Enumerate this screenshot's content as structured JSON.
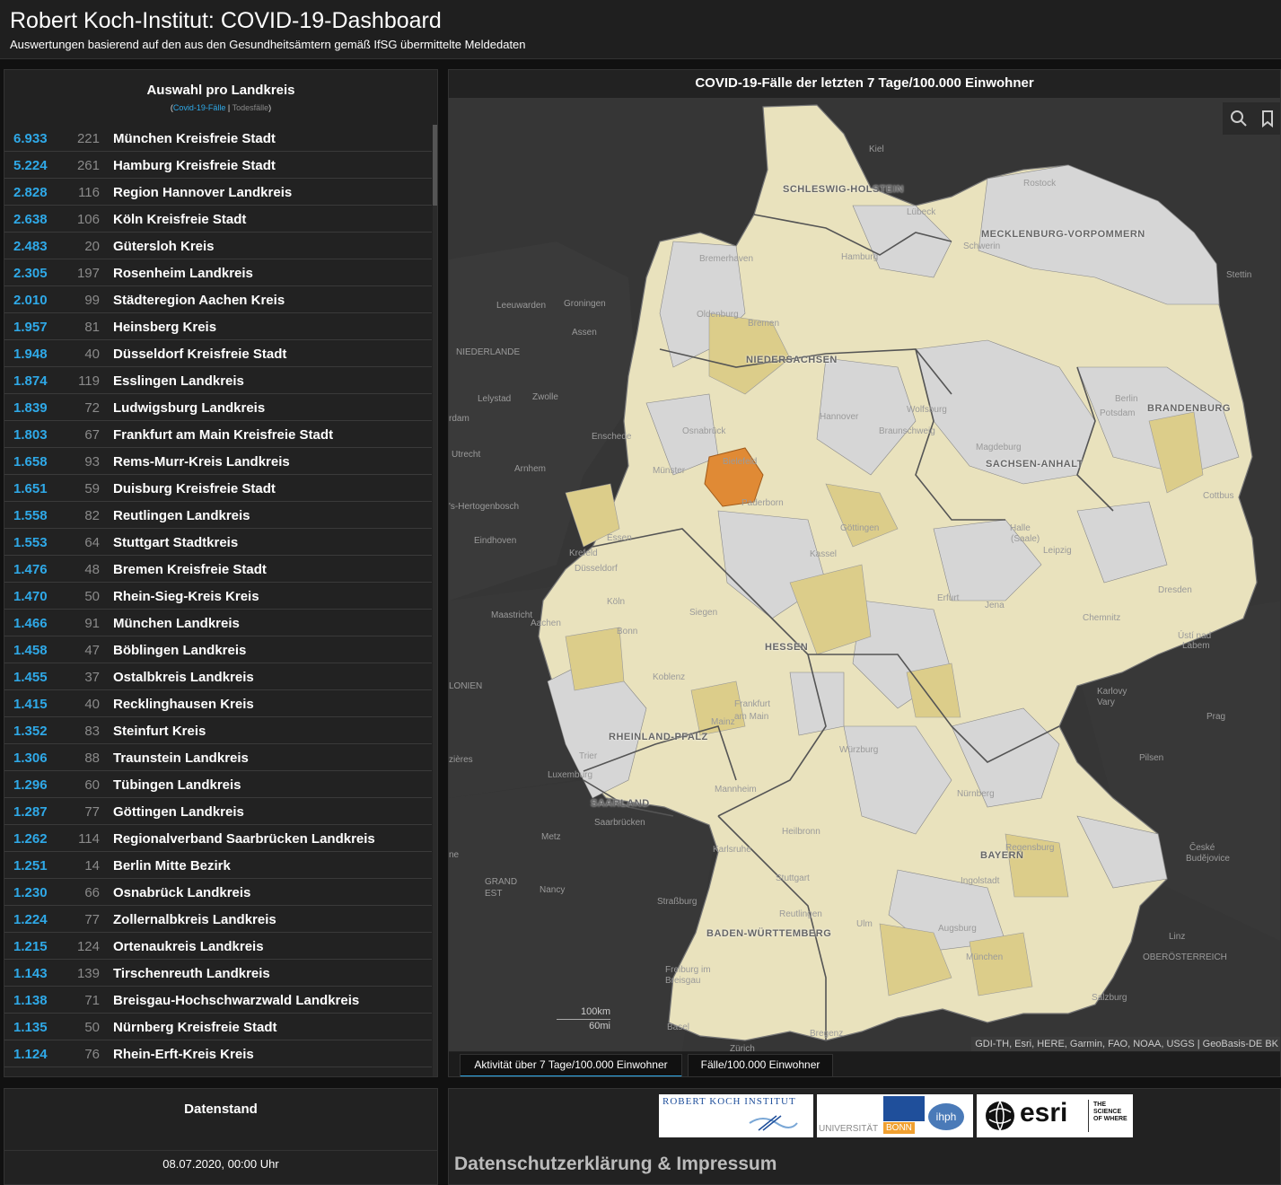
{
  "header": {
    "title": "Robert Koch-Institut: COVID-19-Dashboard",
    "subtitle": "Auswertungen basierend auf den aus den Gesundheitsämtern gemäß IfSG übermittelte Meldedaten"
  },
  "list_panel": {
    "title": "Auswahl pro Landkreis",
    "legend_open": "(",
    "legend_cases": "Covid-19-Fälle",
    "legend_sep": " | ",
    "legend_deaths": "Todesfälle",
    "legend_close": ")",
    "rows": [
      {
        "cases": "6.933",
        "deaths": "221",
        "name": "München Kreisfreie Stadt"
      },
      {
        "cases": "5.224",
        "deaths": "261",
        "name": "Hamburg Kreisfreie Stadt"
      },
      {
        "cases": "2.828",
        "deaths": "116",
        "name": "Region Hannover Landkreis"
      },
      {
        "cases": "2.638",
        "deaths": "106",
        "name": "Köln Kreisfreie Stadt"
      },
      {
        "cases": "2.483",
        "deaths": "20",
        "name": "Gütersloh Kreis"
      },
      {
        "cases": "2.305",
        "deaths": "197",
        "name": "Rosenheim Landkreis"
      },
      {
        "cases": "2.010",
        "deaths": "99",
        "name": "Städteregion Aachen Kreis"
      },
      {
        "cases": "1.957",
        "deaths": "81",
        "name": "Heinsberg Kreis"
      },
      {
        "cases": "1.948",
        "deaths": "40",
        "name": "Düsseldorf Kreisfreie Stadt"
      },
      {
        "cases": "1.874",
        "deaths": "119",
        "name": "Esslingen Landkreis"
      },
      {
        "cases": "1.839",
        "deaths": "72",
        "name": "Ludwigsburg Landkreis"
      },
      {
        "cases": "1.803",
        "deaths": "67",
        "name": "Frankfurt am Main Kreisfreie Stadt"
      },
      {
        "cases": "1.658",
        "deaths": "93",
        "name": "Rems-Murr-Kreis Landkreis"
      },
      {
        "cases": "1.651",
        "deaths": "59",
        "name": "Duisburg Kreisfreie Stadt"
      },
      {
        "cases": "1.558",
        "deaths": "82",
        "name": "Reutlingen Landkreis"
      },
      {
        "cases": "1.553",
        "deaths": "64",
        "name": "Stuttgart Stadtkreis"
      },
      {
        "cases": "1.476",
        "deaths": "48",
        "name": "Bremen Kreisfreie Stadt"
      },
      {
        "cases": "1.470",
        "deaths": "50",
        "name": "Rhein-Sieg-Kreis Kreis"
      },
      {
        "cases": "1.466",
        "deaths": "91",
        "name": "München Landkreis"
      },
      {
        "cases": "1.458",
        "deaths": "47",
        "name": "Böblingen Landkreis"
      },
      {
        "cases": "1.455",
        "deaths": "37",
        "name": "Ostalbkreis Landkreis"
      },
      {
        "cases": "1.415",
        "deaths": "40",
        "name": "Recklinghausen Kreis"
      },
      {
        "cases": "1.352",
        "deaths": "83",
        "name": "Steinfurt Kreis"
      },
      {
        "cases": "1.306",
        "deaths": "88",
        "name": "Traunstein Landkreis"
      },
      {
        "cases": "1.296",
        "deaths": "60",
        "name": "Tübingen Landkreis"
      },
      {
        "cases": "1.287",
        "deaths": "77",
        "name": "Göttingen Landkreis"
      },
      {
        "cases": "1.262",
        "deaths": "114",
        "name": "Regionalverband Saarbrücken Landkreis"
      },
      {
        "cases": "1.251",
        "deaths": "14",
        "name": "Berlin Mitte Bezirk"
      },
      {
        "cases": "1.230",
        "deaths": "66",
        "name": "Osnabrück Landkreis"
      },
      {
        "cases": "1.224",
        "deaths": "77",
        "name": "Zollernalbkreis Landkreis"
      },
      {
        "cases": "1.215",
        "deaths": "124",
        "name": "Ortenaukreis Landkreis"
      },
      {
        "cases": "1.143",
        "deaths": "139",
        "name": "Tirschenreuth Landkreis"
      },
      {
        "cases": "1.138",
        "deaths": "71",
        "name": "Breisgau-Hochschwarzwald Landkreis"
      },
      {
        "cases": "1.135",
        "deaths": "50",
        "name": "Nürnberg Kreisfreie Stadt"
      },
      {
        "cases": "1.124",
        "deaths": "76",
        "name": "Rhein-Erft-Kreis Kreis"
      }
    ]
  },
  "map_panel": {
    "title": "COVID-19-Fälle der letzten 7 Tage/100.000 Einwohner",
    "tools": {
      "search_icon": "search-icon",
      "bookmark_icon": "bookmark-icon"
    },
    "states": [
      {
        "label": "SCHLESWIG-HOLSTEIN"
      },
      {
        "label": "MECKLENBURG-VORPOMMERN"
      },
      {
        "label": "NIEDERSACHSEN"
      },
      {
        "label": "BRANDENBURG"
      },
      {
        "label": "SACHSEN-ANHALT"
      },
      {
        "label": "HESSEN"
      },
      {
        "label": "RHEINLAND-PFALZ"
      },
      {
        "label": "SAARLAND"
      },
      {
        "label": "BAYERN"
      },
      {
        "label": "BADEN-WÜRTTEMBERG"
      }
    ],
    "cities": [
      {
        "label": "Kiel"
      },
      {
        "label": "Rostock"
      },
      {
        "label": "Lübeck"
      },
      {
        "label": "Schwerin"
      },
      {
        "label": "Hamburg"
      },
      {
        "label": "Bremerhaven"
      },
      {
        "label": "Stettin"
      },
      {
        "label": "Oldenburg"
      },
      {
        "label": "Bremen"
      },
      {
        "label": "Groningen"
      },
      {
        "label": "Leeuwarden"
      },
      {
        "label": "Assen"
      },
      {
        "label": "NIEDERLANDE"
      },
      {
        "label": "Lelystad"
      },
      {
        "label": "Zwolle"
      },
      {
        "label": "Berlin"
      },
      {
        "label": "Potsdam"
      },
      {
        "label": "Hannover"
      },
      {
        "label": "Wolfsburg"
      },
      {
        "label": "Braunschweig"
      },
      {
        "label": "Magdeburg"
      },
      {
        "label": "Osnabrück"
      },
      {
        "label": "Enschede"
      },
      {
        "label": "Utrecht"
      },
      {
        "label": "Arnhem"
      },
      {
        "label": "Münster"
      },
      {
        "label": "Bielefeld"
      },
      {
        "label": "Paderborn"
      },
      {
        "label": "Cottbus"
      },
      {
        "label": "'s-Hertogenbosch"
      },
      {
        "label": "Eindhoven"
      },
      {
        "label": "Essen"
      },
      {
        "label": "Göttingen"
      },
      {
        "label": "Halle"
      },
      {
        "label": "(Saale)"
      },
      {
        "label": "Leipzig"
      },
      {
        "label": "Krefeld"
      },
      {
        "label": "Düsseldorf"
      },
      {
        "label": "Kassel"
      },
      {
        "label": "Dresden"
      },
      {
        "label": "Köln"
      },
      {
        "label": "Erfurt"
      },
      {
        "label": "Jena"
      },
      {
        "label": "Maastricht"
      },
      {
        "label": "Aachen"
      },
      {
        "label": "Siegen"
      },
      {
        "label": "Chemnitz"
      },
      {
        "label": "Bonn"
      },
      {
        "label": "Ústí nad"
      },
      {
        "label": "Labem"
      },
      {
        "label": "Koblenz"
      },
      {
        "label": "Karlovy"
      },
      {
        "label": "Vary"
      },
      {
        "label": "Frankfurt"
      },
      {
        "label": "am Main"
      },
      {
        "label": "Prag"
      },
      {
        "label": "Mainz"
      },
      {
        "label": "Würzburg"
      },
      {
        "label": "Trier"
      },
      {
        "label": "Pilsen"
      },
      {
        "label": "Luxemburg"
      },
      {
        "label": "Mannheim"
      },
      {
        "label": "Nürnberg"
      },
      {
        "label": "Saarbrücken"
      },
      {
        "label": "Heilbronn"
      },
      {
        "label": "Metz"
      },
      {
        "label": "Regensburg"
      },
      {
        "label": "Karlsruhe"
      },
      {
        "label": "České"
      },
      {
        "label": "Budějovice"
      },
      {
        "label": "Stuttgart"
      },
      {
        "label": "Ingolstadt"
      },
      {
        "label": "Nancy"
      },
      {
        "label": "GRAND"
      },
      {
        "label": "EST"
      },
      {
        "label": "Straßburg"
      },
      {
        "label": "Reutlingen"
      },
      {
        "label": "Ulm"
      },
      {
        "label": "Augsburg"
      },
      {
        "label": "Linz"
      },
      {
        "label": "München"
      },
      {
        "label": "OBERÖSTERREICH"
      },
      {
        "label": "Freiburg im"
      },
      {
        "label": "Breisgau"
      },
      {
        "label": "Salzburg"
      },
      {
        "label": "Basel"
      },
      {
        "label": "Bregenz"
      },
      {
        "label": "Zürich"
      },
      {
        "label": "LONIEN"
      },
      {
        "label": "rdam"
      },
      {
        "label": "ne"
      },
      {
        "label": "zières"
      }
    ],
    "scale_km": "100km",
    "scale_mi": "60mi",
    "attribution": "GDI-TH, Esri, HERE, Garmin, FAO, NOAA, USGS | GeoBasis-DE BK",
    "tabs": [
      {
        "label": "Aktivität über 7 Tage/100.000 Einwohner"
      },
      {
        "label": "Fälle/100.000 Einwohner"
      }
    ]
  },
  "date_panel": {
    "title": "Datenstand",
    "value": "08.07.2020, 00:00 Uhr"
  },
  "footer": {
    "rki_logo_text": "ROBERT KOCH INSTITUT",
    "uni_logo_text": "UNIVERSITÄT",
    "uni_logo_bonn": "BONN",
    "ihph_text": "ihph",
    "esri_logo_text": "esri",
    "esri_tag": "THE SCIENCE OF WHERE",
    "imprint_link": "Datenschutzerklärung & Impressum"
  },
  "colors": {
    "accent": "#2fa9e8",
    "map_low": "#d6d6d6",
    "map_mid": "#e9e2bd",
    "map_high": "#dbc97e",
    "map_peak": "#e08a35"
  }
}
